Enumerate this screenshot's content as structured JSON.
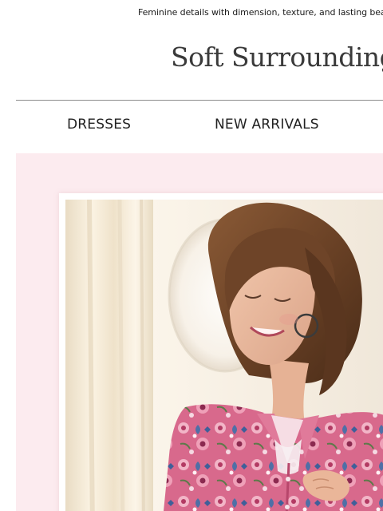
{
  "preheader": {
    "text": "Feminine details with dimension, texture, and lasting beauty"
  },
  "brand": {
    "logo_text": "Soft Surroundings"
  },
  "nav": {
    "items": [
      {
        "label": "DRESSES"
      },
      {
        "label": "NEW ARRIVALS"
      }
    ]
  },
  "hero": {
    "image_alt": "Woman smiling in a pink floral print shirt",
    "colors": {
      "background": "#fcebef",
      "frame": "#ffffff",
      "blouse": "#c9567a"
    }
  }
}
